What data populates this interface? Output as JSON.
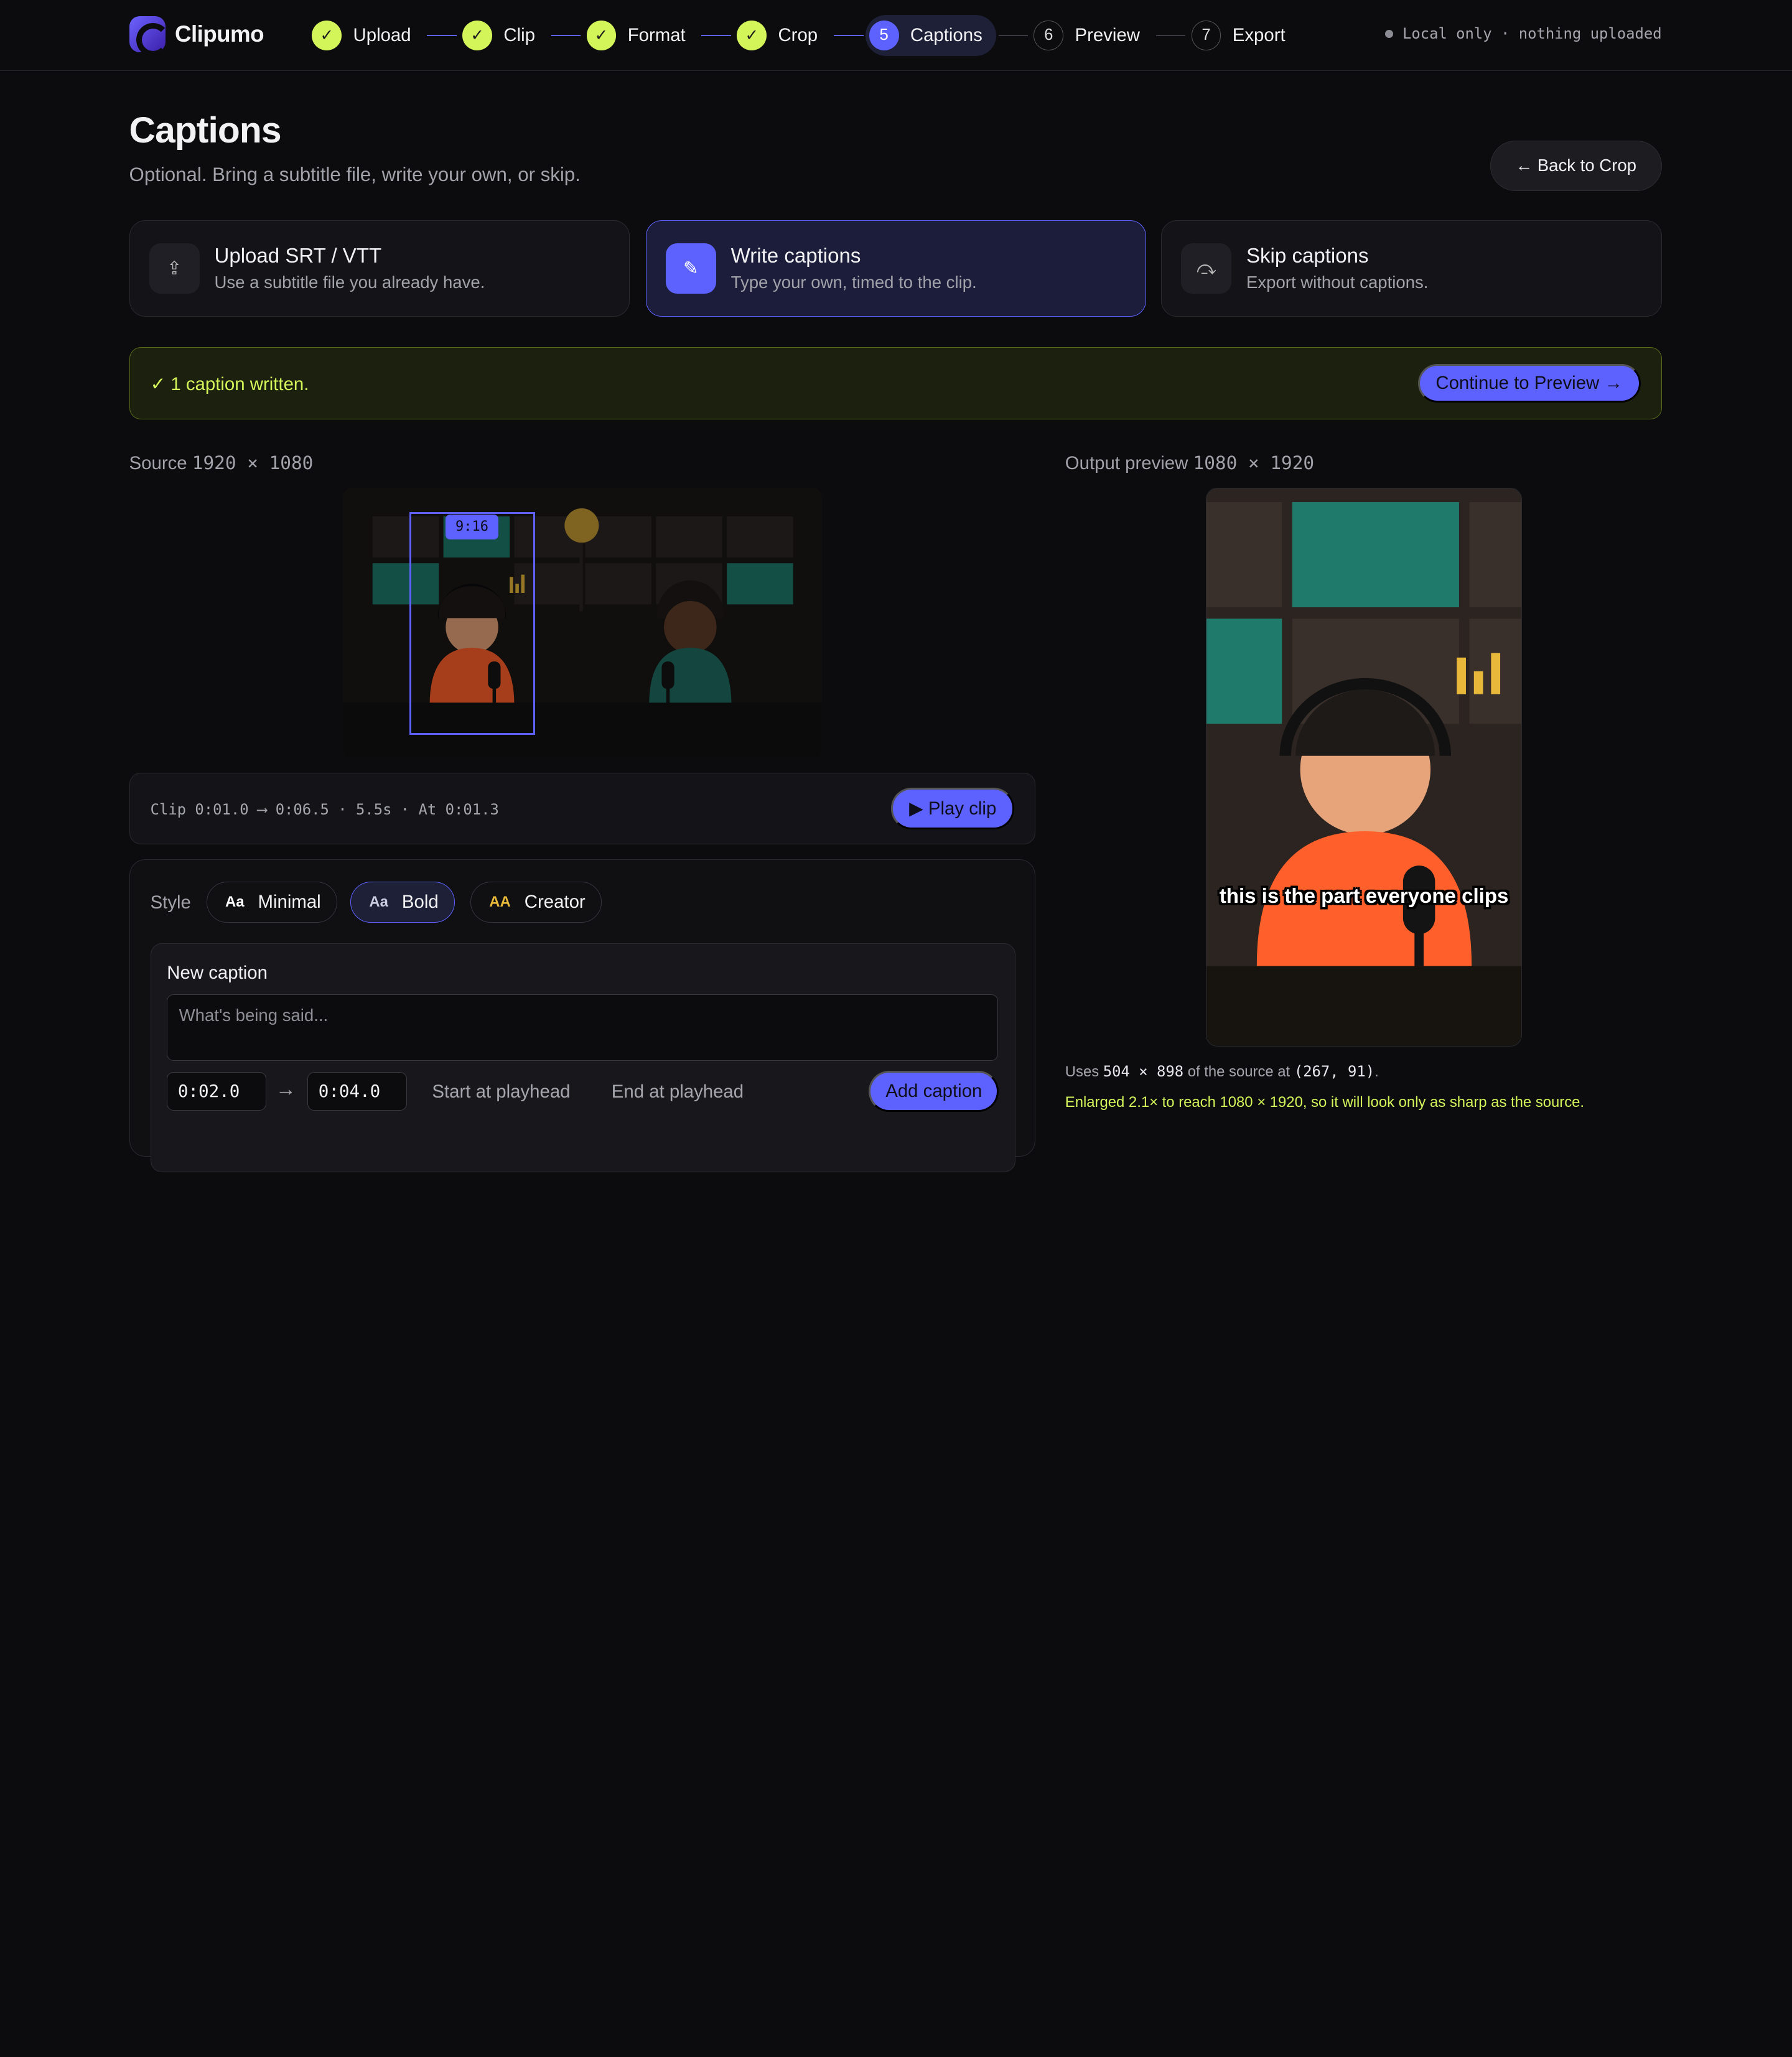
{
  "app": {
    "name": "Clipumo"
  },
  "steps": [
    {
      "label": "Upload",
      "state": "done",
      "marker": "✓"
    },
    {
      "label": "Clip",
      "state": "done",
      "marker": "✓"
    },
    {
      "label": "Format",
      "state": "done",
      "marker": "✓"
    },
    {
      "label": "Crop",
      "state": "done",
      "marker": "✓"
    },
    {
      "label": "Captions",
      "state": "active",
      "marker": "5"
    },
    {
      "label": "Preview",
      "state": "todo",
      "marker": "6"
    },
    {
      "label": "Export",
      "state": "todo",
      "marker": "7"
    }
  ],
  "privacy_note": "Local only · nothing uploaded",
  "header": {
    "title": "Captions",
    "subtitle": "Optional. Bring a subtitle file, write your own, or skip.",
    "back_label": "← Back to Crop"
  },
  "options": [
    {
      "title": "Upload SRT / VTT",
      "desc": "Use a subtitle file you already have.",
      "icon": "upload-icon",
      "glyph": "⇪",
      "selected": false
    },
    {
      "title": "Write captions",
      "desc": "Type your own, timed to the clip.",
      "icon": "pencil-icon",
      "glyph": "✎",
      "selected": true
    },
    {
      "title": "Skip captions",
      "desc": "Export without captions.",
      "icon": "skip-icon",
      "glyph": "⤼",
      "selected": false
    }
  ],
  "banner": {
    "message": "✓ 1 caption written.",
    "continue_label": "Continue to Preview →"
  },
  "source": {
    "label": "Source",
    "dims": "1920 × 1080",
    "crop_tag": "9:16"
  },
  "output": {
    "label": "Output preview",
    "dims": "1080 × 1920",
    "caption_text": "this is the part everyone clips"
  },
  "clip": {
    "info": "Clip 0:01.0 ⟶ 0:06.5 · 5.5s · At 0:01.3",
    "play_label": "▶ Play clip"
  },
  "editor": {
    "style_label": "Style",
    "styles": [
      {
        "badge": "Aa",
        "label": "Minimal",
        "selected": false,
        "badge_color": "#ffffff"
      },
      {
        "badge": "Aa",
        "label": "Bold",
        "selected": true,
        "badge_color": "#c9cbe0"
      },
      {
        "badge": "AA",
        "label": "Creator",
        "selected": false,
        "badge_color": "#e8b83a"
      }
    ],
    "new_caption_title": "New caption",
    "caption_placeholder": "What's being said...",
    "start_time": "0:02.0",
    "end_time": "0:04.0",
    "arrow": "→",
    "start_at_playhead": "Start at playhead",
    "end_at_playhead": "End at playhead",
    "add_label": "Add caption"
  },
  "source_usage": {
    "prefix": "Uses",
    "size": "504 × 898",
    "middle": "of the source at",
    "position": "(267, 91)",
    "suffix": ".",
    "enlarge_note": "Enlarged 2.1× to reach 1080 × 1920, so it will look only as sharp as the source."
  },
  "colors": {
    "accent": "#5d62ff",
    "done": "#d4f55a",
    "background": "#0c0c0e",
    "shirt": "#ff5f2a",
    "teal": "#1f7a6c"
  }
}
